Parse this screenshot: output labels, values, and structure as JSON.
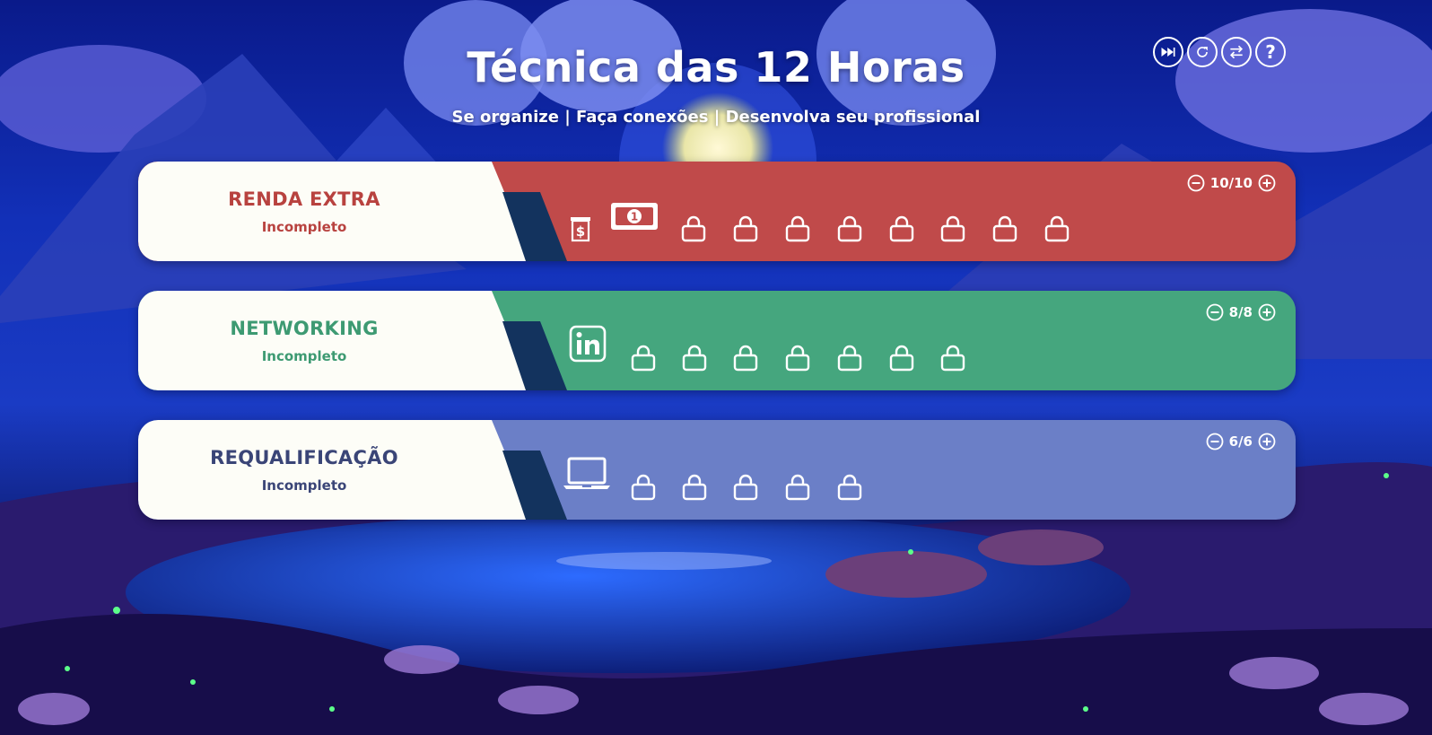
{
  "header": {
    "title": "Técnica das 12 Horas",
    "subtitle": "Se organize | Faça conexões | Desenvolva seu profissional"
  },
  "controls": {
    "skip_icon": "fast-forward-icon",
    "reset_icon": "refresh-icon",
    "swap_icon": "swap-arrows-icon",
    "help_label": "?"
  },
  "cards": [
    {
      "name": "RENDA EXTRA",
      "status": "Incompleto",
      "counter": "10/10",
      "color": "#c04a4a",
      "accent": "#b8423f",
      "unlocked_icons": [
        "receipt-dollar-icon",
        "banknote-icon"
      ],
      "locked_count": 8
    },
    {
      "name": "NETWORKING",
      "status": "Incompleto",
      "counter": "8/8",
      "color": "#45a67e",
      "accent": "#3d9a72",
      "unlocked_icons": [
        "linkedin-icon"
      ],
      "locked_count": 7
    },
    {
      "name": "REQUALIFICAÇÃO",
      "status": "Incompleto",
      "counter": "6/6",
      "color": "#6b7fc7",
      "accent": "#3a4577",
      "unlocked_icons": [
        "laptop-icon"
      ],
      "locked_count": 5
    }
  ]
}
